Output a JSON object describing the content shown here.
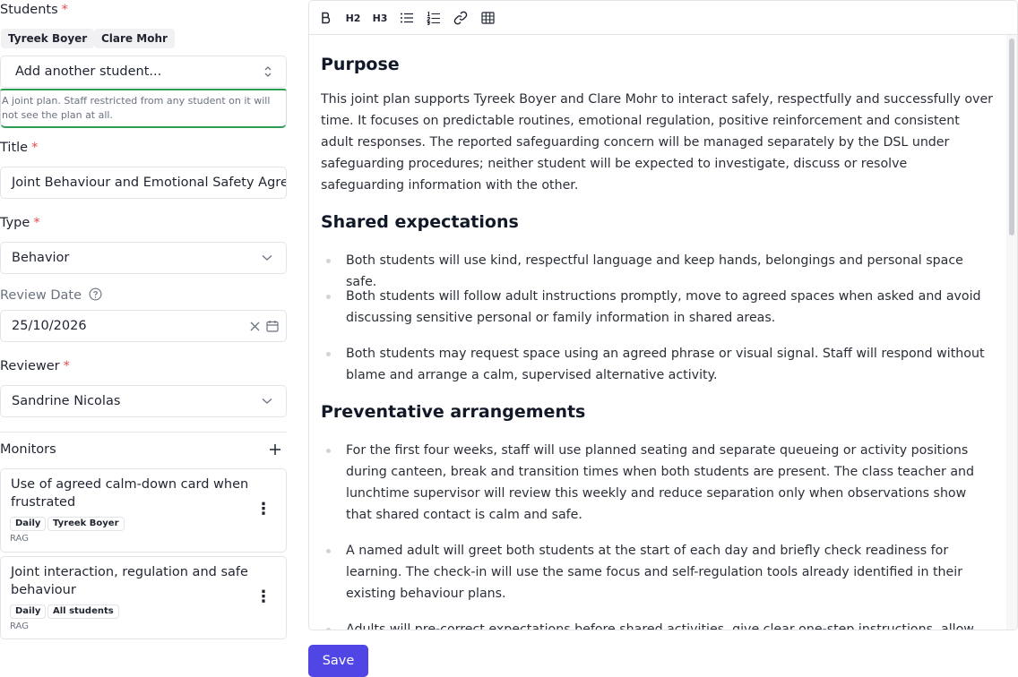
{
  "form": {
    "students_label": "Students",
    "required_mark": "*",
    "students": [
      "Tyreek Boyer",
      "Clare Mohr"
    ],
    "add_student_placeholder": "Add another student...",
    "joint_hint": "A joint plan. Staff restricted from any student on it will not see the plan at all.",
    "title_label": "Title",
    "title_value": "Joint Behaviour and Emotional Safety Agreement",
    "type_label": "Type",
    "type_value": "Behavior",
    "review_date_label": "Review Date",
    "review_date_value": "25/10/2026",
    "reviewer_label": "Reviewer",
    "reviewer_value": "Sandrine Nicolas"
  },
  "monitors": {
    "label": "Monitors",
    "items": [
      {
        "title": "Use of agreed calm-down card when frustrated",
        "frequency": "Daily",
        "target": "Tyreek Boyer",
        "kind": "RAG"
      },
      {
        "title": "Joint interaction, regulation and safe behaviour",
        "frequency": "Daily",
        "target": "All students",
        "kind": "RAG"
      }
    ]
  },
  "toolbar": {
    "icons": [
      "bold-icon",
      "heading-2-icon",
      "heading-3-icon",
      "bullet-list-icon",
      "ordered-list-icon",
      "link-icon",
      "table-icon"
    ],
    "h2": "H2",
    "h3": "H3"
  },
  "document": {
    "purpose_heading": "Purpose",
    "purpose_text": "This joint plan supports Tyreek Boyer and Clare Mohr to interact safely, respectfully and successfully over time. It focuses on predictable routines, emotional regulation, positive reinforcement and consistent adult responses. The reported safeguarding concern will be managed separately by the DSL under safeguarding procedures; neither student will be expected to investigate, discuss or resolve safeguarding information with the other.",
    "shared_heading": "Shared expectations",
    "shared_items": [
      "Both students will use kind, respectful language and keep hands, belongings and personal space safe.",
      "Both students will follow adult instructions promptly, move to agreed spaces when asked and avoid discussing sensitive personal or family information in shared areas.",
      "Both students may request space using an agreed phrase or visual signal. Staff will respond without blame and arrange a calm, supervised alternative activity."
    ],
    "preventative_heading": "Preventative arrangements",
    "preventative_items": [
      "For the first four weeks, staff will use planned seating and separate queueing or activity positions during canteen, break and transition times when both students are present. The class teacher and lunchtime supervisor will review this weekly and reduce separation only when observations show that shared contact is calm and safe.",
      "A named adult will greet both students at the start of each day and briefly check readiness for learning. The check-in will use the same focus and self-regulation tools already identified in their existing behaviour plans.",
      "Adults will pre-correct expectations before shared activities, give clear one-step instructions, allow"
    ]
  },
  "save_label": "Save",
  "colors": {
    "accent": "#5046e5",
    "hint_border": "#2a9d52",
    "required": "#e5484d"
  }
}
